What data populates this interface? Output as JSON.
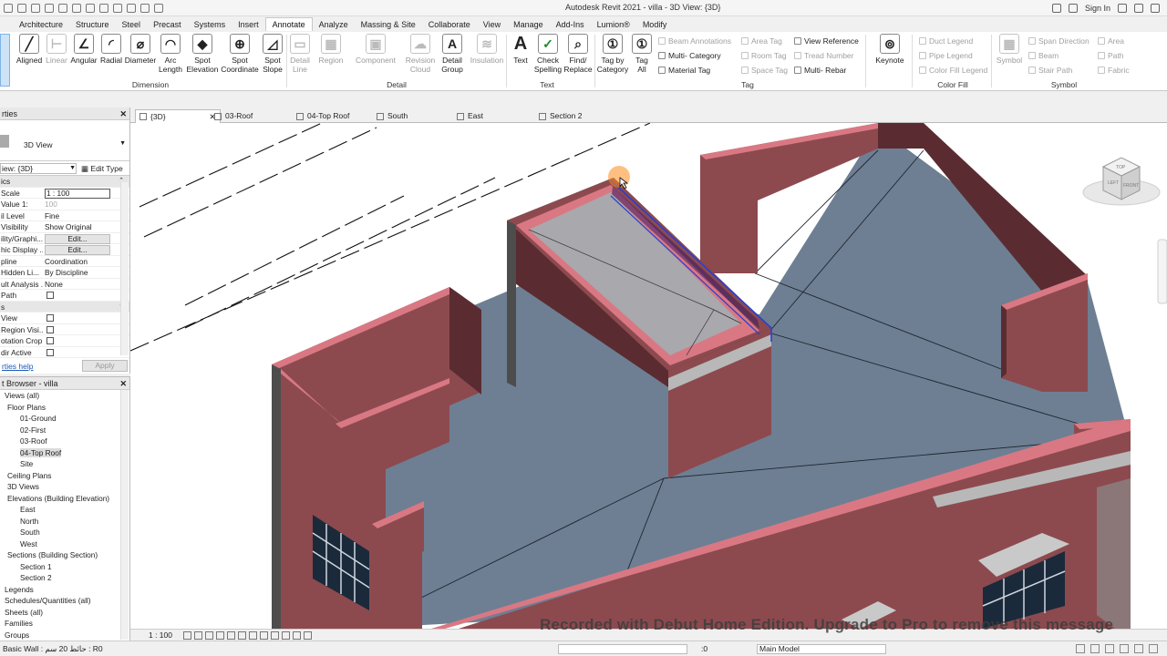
{
  "app": {
    "title": "Autodesk Revit 2021 - villa - 3D View: {3D}",
    "sign_in": "Sign In"
  },
  "ribbon_tabs": [
    "Architecture",
    "Structure",
    "Steel",
    "Precast",
    "Systems",
    "Insert",
    "Annotate",
    "Analyze",
    "Massing & Site",
    "Collaborate",
    "View",
    "Manage",
    "Add-Ins",
    "Lumion®",
    "Modify"
  ],
  "active_tab": "Annotate",
  "ribbon": {
    "modify_label": "fy",
    "dimension": {
      "group": "Dimension",
      "tools": [
        "Aligned",
        "Linear",
        "Angular",
        "Radial",
        "Diameter",
        "Arc Length",
        "Spot Elevation",
        "Spot Coordinate",
        "Spot Slope"
      ],
      "disabled": [
        "Linear"
      ]
    },
    "detail": {
      "group": "Detail",
      "tools": [
        "Detail Line",
        "Region",
        "Component",
        "Revision Cloud",
        "Detail Group",
        "Insulation"
      ],
      "disabled": [
        "Detail Line",
        "Region",
        "Component",
        "Revision Cloud",
        "Insulation"
      ]
    },
    "text": {
      "group": "Text",
      "tools": [
        "Text",
        "Check Spelling",
        "Find/ Replace"
      ]
    },
    "tag": {
      "group": "Tag",
      "tools": [
        "Tag by Category",
        "Tag All"
      ],
      "small_tools": [
        "Beam Annotations",
        "Multi- Category",
        "Material Tag",
        "Area Tag",
        "Room Tag",
        "Space Tag",
        "View Reference",
        "Tread Number",
        "Multi- Rebar"
      ],
      "disabled_small": [
        "Beam Annotations",
        "Area Tag",
        "Room Tag",
        "Space Tag",
        "Tread Number"
      ]
    },
    "keynote": {
      "label": "Keynote"
    },
    "color_fill": {
      "group": "Color Fill",
      "tools": [
        "Duct Legend",
        "Pipe Legend",
        "Color Fill Legend"
      ]
    },
    "symbol": {
      "group": "Symbol",
      "tools": [
        "Symbol",
        "Span Direction",
        "Beam",
        "Stair Path",
        "Area",
        "Path",
        "Fabric"
      ]
    }
  },
  "properties": {
    "title": "rties",
    "type": "3D View",
    "view_select": "iew: {3D}",
    "edit_type": "Edit Type",
    "rows": [
      {
        "k": "ics",
        "v": "",
        "section": true
      },
      {
        "k": "Scale",
        "v": "1 : 100",
        "style": "box"
      },
      {
        "k": "Value  1:",
        "v": "100",
        "style": "gray"
      },
      {
        "k": "il Level",
        "v": "Fine"
      },
      {
        "k": "Visibility",
        "v": "Show Original"
      },
      {
        "k": "ility/Graphi...",
        "v": "Edit...",
        "style": "btn"
      },
      {
        "k": "hic Display ...",
        "v": "Edit...",
        "style": "btn"
      },
      {
        "k": "pline",
        "v": "Coordination"
      },
      {
        "k": "Hidden Li...",
        "v": "By Discipline"
      },
      {
        "k": "ult Analysis ...",
        "v": "None"
      },
      {
        "k": "Path",
        "v": "",
        "style": "chk"
      },
      {
        "k": "s",
        "v": "",
        "section": true
      },
      {
        "k": "View",
        "v": "",
        "style": "chk"
      },
      {
        "k": "Region Visi...",
        "v": "",
        "style": "chk"
      },
      {
        "k": "otation Crop",
        "v": "",
        "style": "chk"
      },
      {
        "k": "dir Active",
        "v": "",
        "style": "chk"
      }
    ],
    "help": "rties help",
    "apply": "Apply"
  },
  "browser": {
    "title": "t Browser - villa",
    "nodes": [
      {
        "label": "Views (all)",
        "depth": 1
      },
      {
        "label": "Floor Plans",
        "depth": 2
      },
      {
        "label": "01-Ground",
        "depth": 3
      },
      {
        "label": "02-First",
        "depth": 3
      },
      {
        "label": "03-Roof",
        "depth": 3
      },
      {
        "label": "04-Top Roof",
        "depth": 3,
        "selected": true
      },
      {
        "label": "Site",
        "depth": 3
      },
      {
        "label": "Ceiling Plans",
        "depth": 2
      },
      {
        "label": "3D Views",
        "depth": 2
      },
      {
        "label": "Elevations (Building Elevation)",
        "depth": 2
      },
      {
        "label": "East",
        "depth": 3
      },
      {
        "label": "North",
        "depth": 3
      },
      {
        "label": "South",
        "depth": 3
      },
      {
        "label": "West",
        "depth": 3
      },
      {
        "label": "Sections (Building Section)",
        "depth": 2
      },
      {
        "label": "Section 1",
        "depth": 3
      },
      {
        "label": "Section 2",
        "depth": 3
      },
      {
        "label": "Legends",
        "depth": 1
      },
      {
        "label": "Schedules/Quantities (all)",
        "depth": 1
      },
      {
        "label": "Sheets (all)",
        "depth": 1
      },
      {
        "label": "Families",
        "depth": 1
      },
      {
        "label": "Groups",
        "depth": 1
      }
    ]
  },
  "view_tabs": [
    "{3D}",
    "03-Roof",
    "04-Top Roof",
    "South",
    "East",
    "Section 2"
  ],
  "view_cube": {
    "top": "TOP",
    "front": "FRONT",
    "left": "LEFT"
  },
  "view_bar": {
    "scale": "1 : 100"
  },
  "status_bar": {
    "text": "Basic Wall : حائط 20 سم : R0",
    "selection_count": ":0",
    "workset": "Main Model"
  },
  "watermark": "Recorded with Debut Home Edition. Upgrade to Pro to remove this message",
  "colors": {
    "wall": "#8c4a4f",
    "wall_dark": "#5a2c31",
    "wall_top": "#d97883",
    "roof": "#6e7f93",
    "selection": "#2a3fd0",
    "highlight": "#ff8a1a"
  }
}
